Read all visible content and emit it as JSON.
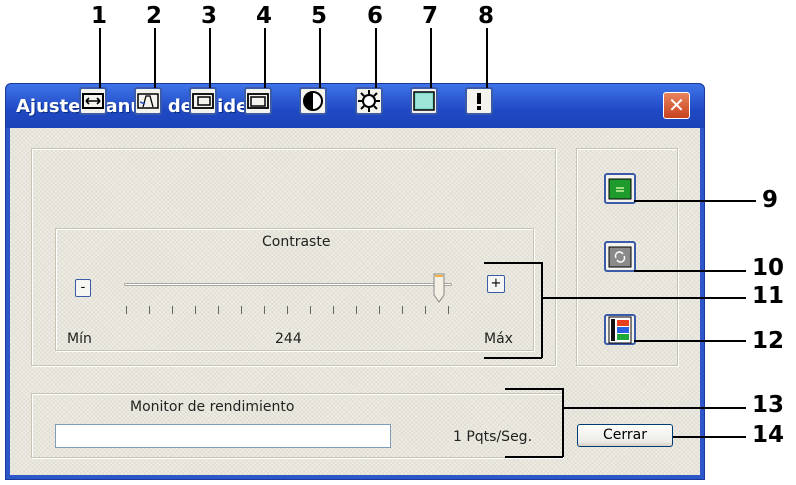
{
  "callouts": [
    "1",
    "2",
    "3",
    "4",
    "5",
    "6",
    "7",
    "8",
    "9",
    "10",
    "11",
    "12",
    "13",
    "14"
  ],
  "window": {
    "title": "Ajuste manual del video"
  },
  "toolbar": {
    "icons": [
      "horizontal-size-icon",
      "keystone-icon",
      "horizontal-position-icon",
      "vertical-position-icon",
      "contrast-icon",
      "brightness-icon",
      "color-icon",
      "advanced-icon"
    ]
  },
  "slider": {
    "label": "Contraste",
    "min_label": "Mín",
    "max_label": "Máx",
    "value_text": "244",
    "minus_label": "-",
    "plus_label": "+",
    "value_fraction": 0.96
  },
  "side": {
    "icons": [
      "apply-settings-icon",
      "reset-icon",
      "color-bars-icon"
    ]
  },
  "performance": {
    "label": "Monitor de rendimiento",
    "rate_text": "1  Pqts/Seg."
  },
  "close_button": {
    "label": "Cerrar"
  }
}
